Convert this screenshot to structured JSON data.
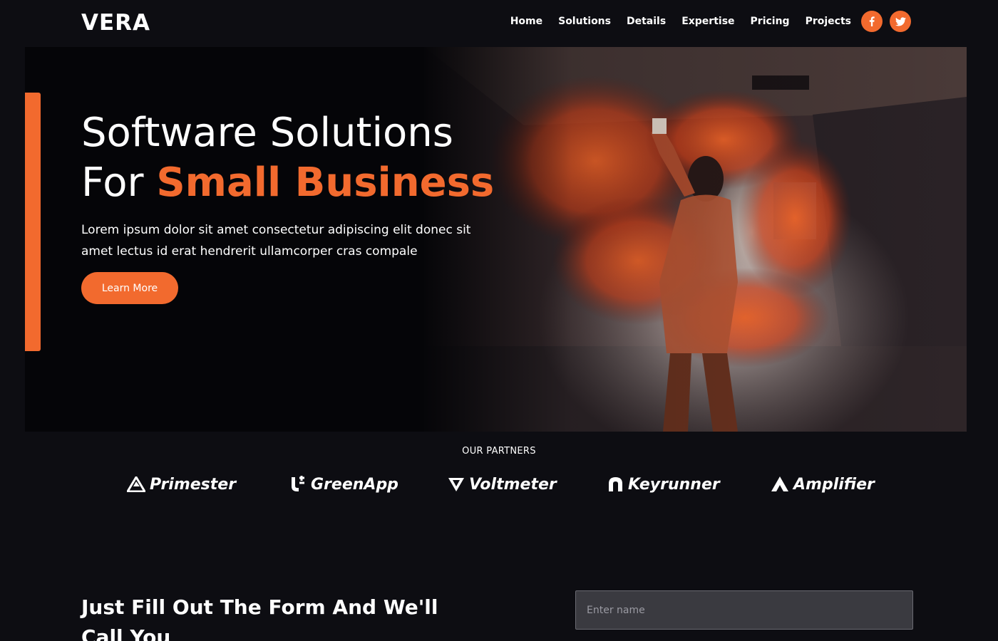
{
  "brand": {
    "logo_text": "VERA",
    "accent_color": "#f26a2e"
  },
  "nav": {
    "links": [
      "Home",
      "Solutions",
      "Details",
      "Expertise",
      "Pricing",
      "Projects"
    ],
    "social": [
      {
        "name": "facebook-icon",
        "glyph": "f"
      },
      {
        "name": "twitter-icon",
        "glyph": "twitter-bird"
      }
    ]
  },
  "hero": {
    "title_line1": "Software Solutions",
    "title_line2_prefix": "For",
    "title_line2_accent": "Small Business",
    "text": "Lorem ipsum dolor sit amet consectetur adipiscing elit donec sit amet lectus id erat hendrerit ullamcorper cras compale",
    "button_label": "Learn More",
    "image": "person-with-orange-smoke-flare"
  },
  "partners": {
    "heading": "OUR PARTNERS",
    "items": [
      {
        "name": "Primester",
        "icon": "primester-logo-icon"
      },
      {
        "name": "GreenApp",
        "icon": "greenapp-logo-icon"
      },
      {
        "name": "Voltmeter",
        "icon": "voltmeter-logo-icon"
      },
      {
        "name": "Keyrunner",
        "icon": "keyrunner-logo-icon"
      },
      {
        "name": "Amplifier",
        "icon": "amplifier-logo-icon"
      }
    ]
  },
  "contact": {
    "title": "Just Fill Out The Form And We'll Call You",
    "name_placeholder": "Enter name"
  }
}
